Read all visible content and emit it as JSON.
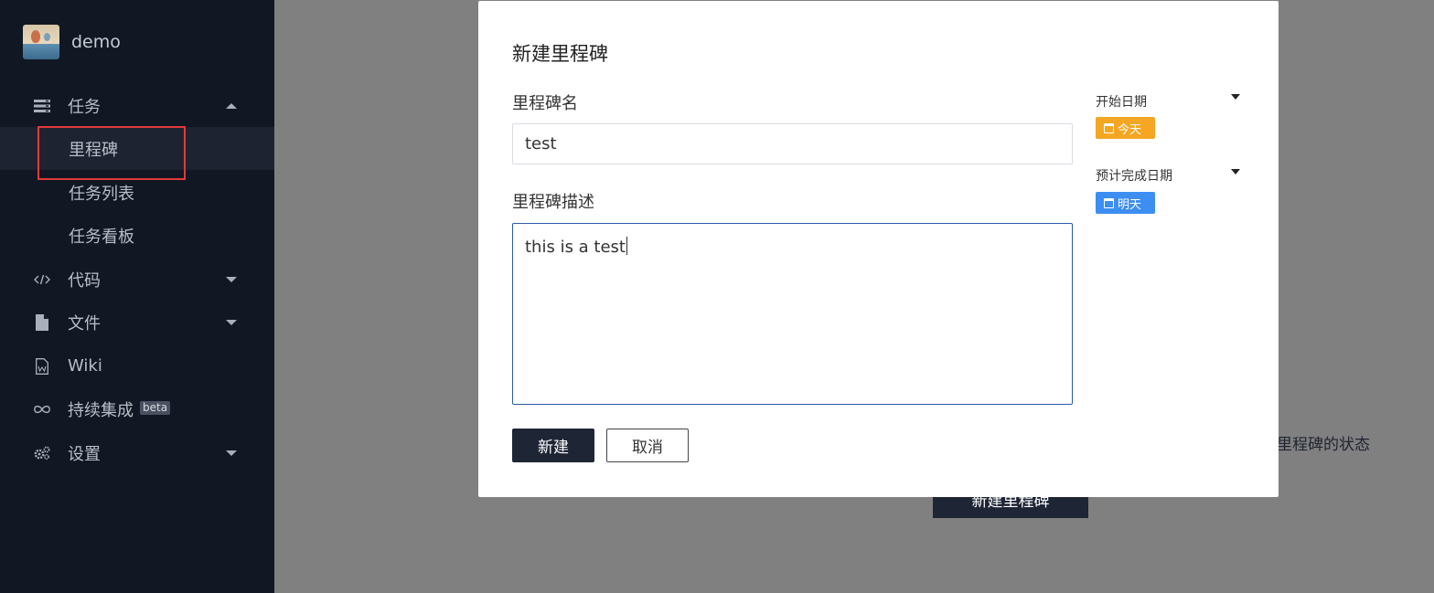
{
  "sidebar": {
    "project_name": "demo",
    "tasks": {
      "label": "任务",
      "icon": "tasks-icon"
    },
    "sub_items": [
      {
        "label": "里程碑"
      },
      {
        "label": "任务列表"
      },
      {
        "label": "任务看板"
      }
    ],
    "code": {
      "label": "代码",
      "icon": "code-icon"
    },
    "files": {
      "label": "文件",
      "icon": "file-icon"
    },
    "wiki": {
      "label": "Wiki",
      "icon": "wiki-icon"
    },
    "ci": {
      "label": "持续集成",
      "badge": "beta",
      "icon": "infinity-icon"
    },
    "settings": {
      "label": "设置",
      "icon": "gears-icon"
    }
  },
  "background": {
    "status_text": "里程碑的状态",
    "create_button": "新建里程碑"
  },
  "modal": {
    "title": "新建里程碑",
    "name_label": "里程碑名",
    "name_value": "test",
    "desc_label": "里程碑描述",
    "desc_value": "this is a test",
    "start_date_label": "开始日期",
    "start_date_value": "今天",
    "end_date_label": "预计完成日期",
    "end_date_value": "明天",
    "create_label": "新建",
    "cancel_label": "取消"
  },
  "colors": {
    "sidebar_bg": "#111723",
    "highlight": "#e23a3a",
    "primary": "#1e2535",
    "start_badge": "#f5a623",
    "end_badge": "#3d8ef2"
  }
}
